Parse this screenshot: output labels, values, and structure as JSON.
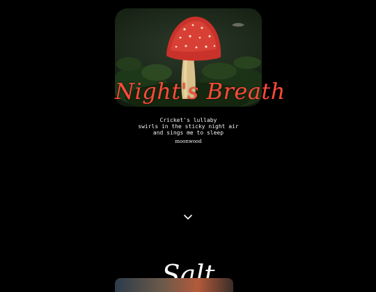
{
  "poem": {
    "title": "Night's Breath",
    "lines": [
      "Cricket's lullaby",
      "swirls in the sticky night air",
      "and sings me to sleep"
    ],
    "author": "moonwood"
  },
  "next_poem": {
    "title": "Salt"
  },
  "icons": {
    "scroll": "chevron-down-icon"
  },
  "colors": {
    "background": "#000000",
    "title_accent": "#ff4a3a",
    "text": "#f2f2f2"
  }
}
